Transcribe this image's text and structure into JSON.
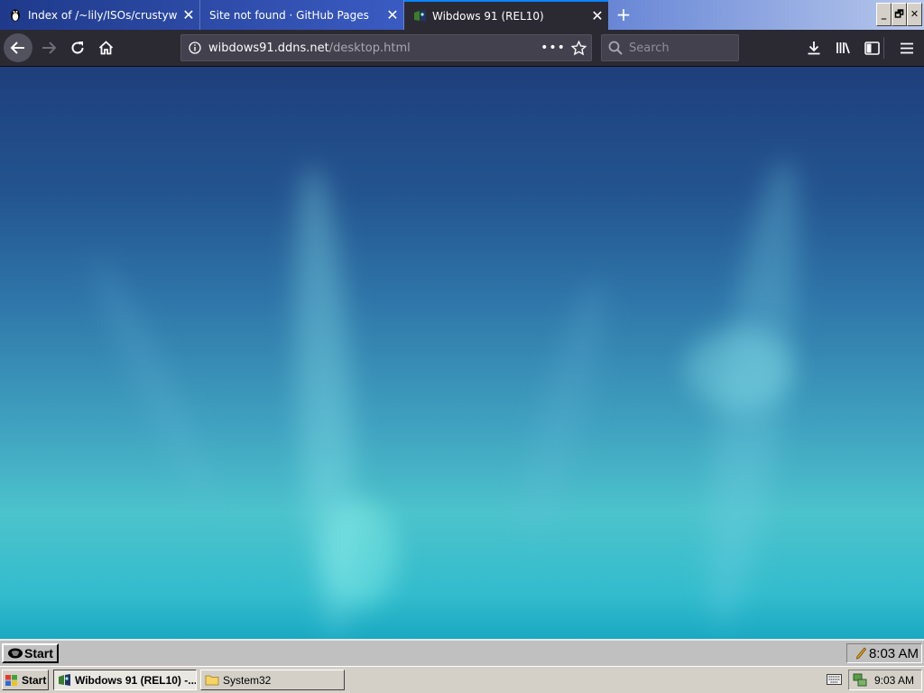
{
  "tabs": [
    {
      "title": "Index of /~lily/ISOs/crustywindow",
      "favicon": "penguin-favicon-icon",
      "close": "✕"
    },
    {
      "title": "Site not found · GitHub Pages",
      "close": "✕"
    },
    {
      "title": "Wibdows 91 (REL10)",
      "favicon": "wibdows-favicon-icon",
      "close": "✕",
      "active": true
    }
  ],
  "new_tab": "+",
  "window_controls": {
    "minimize": "_",
    "maximize": "🗗",
    "close": "✕"
  },
  "urlbar": {
    "host": "wibdows91.ddns.net",
    "path": "/desktop.html",
    "more": "•••"
  },
  "search": {
    "placeholder": "Search"
  },
  "page": {
    "taskbar": {
      "start_label": "Start",
      "clock": "8:03 AM"
    }
  },
  "os_taskbar": {
    "start_label": "Start",
    "tasks": [
      {
        "label": "Wibdows 91 (REL10) -...",
        "active": true
      },
      {
        "label": "System32",
        "active": false
      }
    ],
    "clock": "9:03 AM"
  },
  "colors": {
    "browser_chrome": "#2b2a33",
    "urlbar_bg": "#42414d",
    "accent": "#0a84ff",
    "desktop_top": "#1e3f7c",
    "desktop_bottom": "#1aa9c2",
    "taskbar_gray": "#c0c0c0"
  }
}
